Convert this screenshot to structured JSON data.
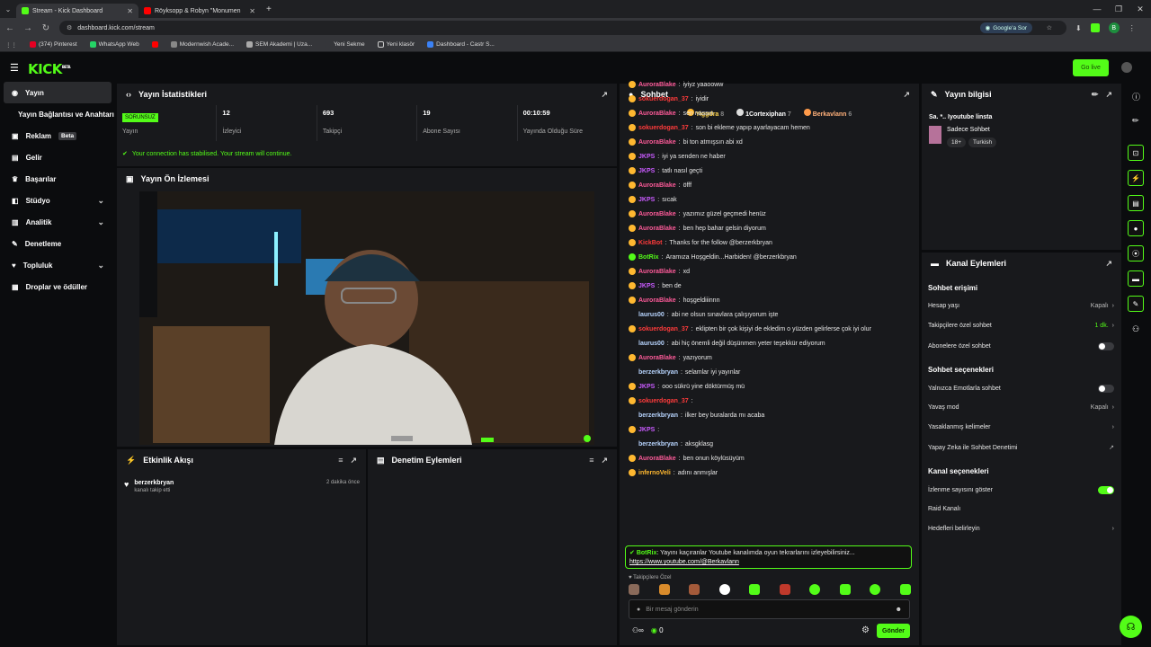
{
  "browser": {
    "tabs": [
      {
        "title": "Stream - Kick Dashboard",
        "color": "#53fc18"
      },
      {
        "title": "Röyksopp & Robyn \"Monumen",
        "color": "#ff0000"
      }
    ],
    "new_tab": "+",
    "url": "dashboard.kick.com/stream",
    "google_sor": "Google'a Sor",
    "profile_initial": "B",
    "bookmarks": [
      "(374) Pinterest",
      "WhatsApp Web",
      "Modernwish Acade...",
      "SEM Akademi | Uza...",
      "Yeni Sekme",
      "Yeni klasör",
      "Dashboard - Castr S..."
    ]
  },
  "kick": {
    "logo": "KICK",
    "go_live": "Go live"
  },
  "sidebar": {
    "items": [
      {
        "label": "Yayın",
        "icon": "camera-icon"
      },
      {
        "label": "Yayın Bağlantısı ve Anahtarı",
        "icon": ""
      },
      {
        "label": "Reklam",
        "icon": "ad-icon",
        "badge": "Beta"
      },
      {
        "label": "Gelir",
        "icon": "money-icon"
      },
      {
        "label": "Başarılar",
        "icon": "trophy-icon"
      },
      {
        "label": "Stüdyo",
        "icon": "studio-icon",
        "chevron": true
      },
      {
        "label": "Analitik",
        "icon": "chart-icon",
        "chevron": true
      },
      {
        "label": "Denetleme",
        "icon": "wrench-icon"
      },
      {
        "label": "Topluluk",
        "icon": "community-icon",
        "chevron": true
      },
      {
        "label": "Droplar ve ödüller",
        "icon": "gift-icon"
      }
    ]
  },
  "stats": {
    "title": "Yayın İstatistikleri",
    "items": [
      {
        "value": "SORUNSUZ",
        "label": "Yayın"
      },
      {
        "value": "12",
        "label": "İzleyici"
      },
      {
        "value": "693",
        "label": "Takipçi"
      },
      {
        "value": "19",
        "label": "Abone Sayısı"
      },
      {
        "value": "00:10:59",
        "label": "Yayında Olduğu Süre"
      }
    ],
    "connection": "Your connection has stabilised. Your stream will continue."
  },
  "preview": {
    "title": "Yayın Ön İzlemesi"
  },
  "events": {
    "title": "Etkinlik Akışı",
    "user": "berzerkbryan",
    "action": "kanalı takip etti",
    "time": "2 dakika önce"
  },
  "moderation": {
    "title": "Denetim Eylemleri"
  },
  "chat": {
    "title": "Sohbet",
    "top": [
      {
        "name": "Yiggdra",
        "count": "8"
      },
      {
        "name": "1Cortexiphan",
        "count": "7"
      },
      {
        "name": "Berkavlann",
        "count": "6"
      }
    ],
    "messages": [
      {
        "user": "AuroraBlake",
        "cls": "u1",
        "text": "iyiyz yaaooww"
      },
      {
        "user": "sokuerdogan_37",
        "cls": "u3",
        "text": "iyidir"
      },
      {
        "user": "AuroraBlake",
        "cls": "u1",
        "text": "sen nassın"
      },
      {
        "user": "sokuerdogan_37",
        "cls": "u3",
        "text": "son bi ekleme yapıp ayarlayacam hemen"
      },
      {
        "user": "AuroraBlake",
        "cls": "u1",
        "text": "bi ton atmışsın abi xd"
      },
      {
        "user": "JKPS",
        "cls": "u2",
        "text": "iyi ya senden ne haber"
      },
      {
        "user": "JKPS",
        "cls": "u2",
        "text": "tatlı nasıl geçti"
      },
      {
        "user": "AuroraBlake",
        "cls": "u1",
        "text": "öfff"
      },
      {
        "user": "JKPS",
        "cls": "u2",
        "text": "sıcak"
      },
      {
        "user": "AuroraBlake",
        "cls": "u1",
        "text": "yazımız güzel geçmedi henüz"
      },
      {
        "user": "AuroraBlake",
        "cls": "u1",
        "text": "ben hep bahar gelsin diyorum"
      },
      {
        "user": "KickBot",
        "cls": "u3",
        "text": "Thanks for the follow @berzerkbryan"
      },
      {
        "user": "BotRix",
        "cls": "u5",
        "text": "Aramıza Hoşgeldin...Harbiden! @berzerkbryan"
      },
      {
        "user": "AuroraBlake",
        "cls": "u1",
        "text": "xd"
      },
      {
        "user": "JKPS",
        "cls": "u2",
        "text": "ben de"
      },
      {
        "user": "AuroraBlake",
        "cls": "u1",
        "text": "hoşgeldiiinnn"
      },
      {
        "user": "laurus00",
        "cls": "u4",
        "text": "abi ne olsun sınavlara çalışıyorum işte"
      },
      {
        "user": "sokuerdogan_37",
        "cls": "u3",
        "text": "eklipten bir çok kişiyi de ekledim o yüzden gelirlerse çok iyi olur"
      },
      {
        "user": "laurus00",
        "cls": "u4",
        "text": "abi hiç önemli değil düşünmen yeter teşekkür ediyorum"
      },
      {
        "user": "AuroraBlake",
        "cls": "u1",
        "text": "yazıyorum"
      },
      {
        "user": "berzerkbryan",
        "cls": "u4",
        "text": "selamlar iyi yayınlar"
      },
      {
        "user": "JKPS",
        "cls": "u2",
        "text": "ooo sükrü yine döktürmüş mü"
      },
      {
        "user": "sokuerdogan_37",
        "cls": "u3",
        "text": ""
      },
      {
        "user": "berzerkbryan",
        "cls": "u4",
        "text": "ilker bey buralarda mı acaba"
      },
      {
        "user": "JKPS",
        "cls": "u2",
        "text": ""
      },
      {
        "user": "berzerkbryan",
        "cls": "u4",
        "text": "aksgklasg"
      },
      {
        "user": "AuroraBlake",
        "cls": "u1",
        "text": "ben onun köylüsüyüm"
      },
      {
        "user": "infernoVeli",
        "cls": "u6",
        "text": "adını anmışlar"
      }
    ],
    "pinned": {
      "user": "BotRix",
      "text": "Yayını kaçıranlar Youtube kanalımda oyun tekrarlarını izleyebilirsiniz...",
      "link": "https://www.youtube.com/@Berkavlann"
    },
    "followers_only": "Takipçilere Özel",
    "input_placeholder": "Bir mesaj gönderin",
    "viewer_count": "0",
    "send": "Gönder"
  },
  "info": {
    "title": "Yayın bilgisi",
    "stream_title": "Sa. *.. Iyoutube linsta",
    "category": "Sadece Sohbet",
    "tags": [
      "18+",
      "Turkish"
    ]
  },
  "actions": {
    "title": "Kanal Eylemleri",
    "chat_access": "Sohbet erişimi",
    "account_age": "Hesap yaşı",
    "account_age_val": "Kapalı",
    "followers_chat": "Takipçilere özel sohbet",
    "followers_chat_val": "1 dk.",
    "subs_chat": "Abonelere özel sohbet",
    "chat_options": "Sohbet seçenekleri",
    "emotes_only": "Yalnızca Emotlarla sohbet",
    "slow_mode": "Yavaş mod",
    "slow_mode_val": "Kapalı",
    "banned_words": "Yasaklanmış kelimeler",
    "ai_mod": "Yapay Zeka ile Sohbet Denetimi",
    "channel_options": "Kanal seçenekleri",
    "show_viewers": "İzlenme sayısını göster",
    "raid": "Raid Kanalı",
    "targets": "Hedefleri belirleyin"
  }
}
